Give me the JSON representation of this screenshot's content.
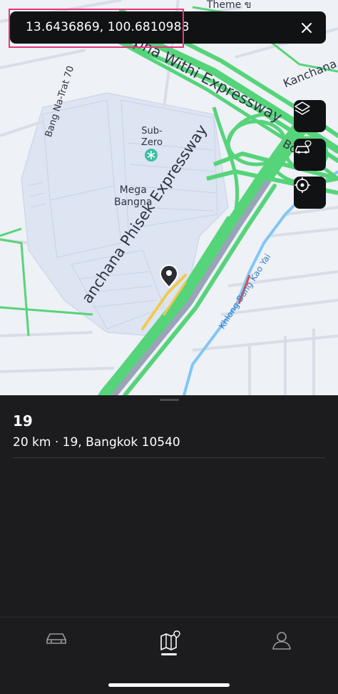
{
  "search_bar": {
    "coordinates": "13.6436869, 100.6810988",
    "close_icon": "close-icon"
  },
  "map": {
    "labels": {
      "road_top_fragment": "Theme ข",
      "expressway_north": "Bang Na-Bang Phli-Bang Pakong Bureepha Withi Expressway",
      "expressway_north_visible": "pha Withi Expressway",
      "kanchana_north": "Kanchana P",
      "bo_fragment": "Bo",
      "bang_na_trat": "Bang Na-Trat 70",
      "sub_zero": "Sub-\nZero",
      "mega_bangna": "Mega\nBangna",
      "kanchana_phisek": "anchana Phisek Expressway",
      "khlong": "Khlong Bang Kao Yai"
    },
    "buttons": {
      "layers_icon": "layers-icon",
      "vehicle_icon": "car-location-icon",
      "locate_icon": "crosshair-icon"
    },
    "colors": {
      "traffic_free": "#56d47a",
      "traffic_slow": "#f2c94c",
      "water": "#7fc7f5",
      "land": "#eef1f6",
      "mall_area": "#dde4f2"
    }
  },
  "place": {
    "title": "19",
    "subtitle": "20 km · 19, Bangkok 10540"
  },
  "tabs": [
    {
      "name": "vehicle",
      "icon": "car-icon",
      "active": false
    },
    {
      "name": "map",
      "icon": "map-pin-icon",
      "active": true
    },
    {
      "name": "profile",
      "icon": "person-icon",
      "active": false
    }
  ]
}
